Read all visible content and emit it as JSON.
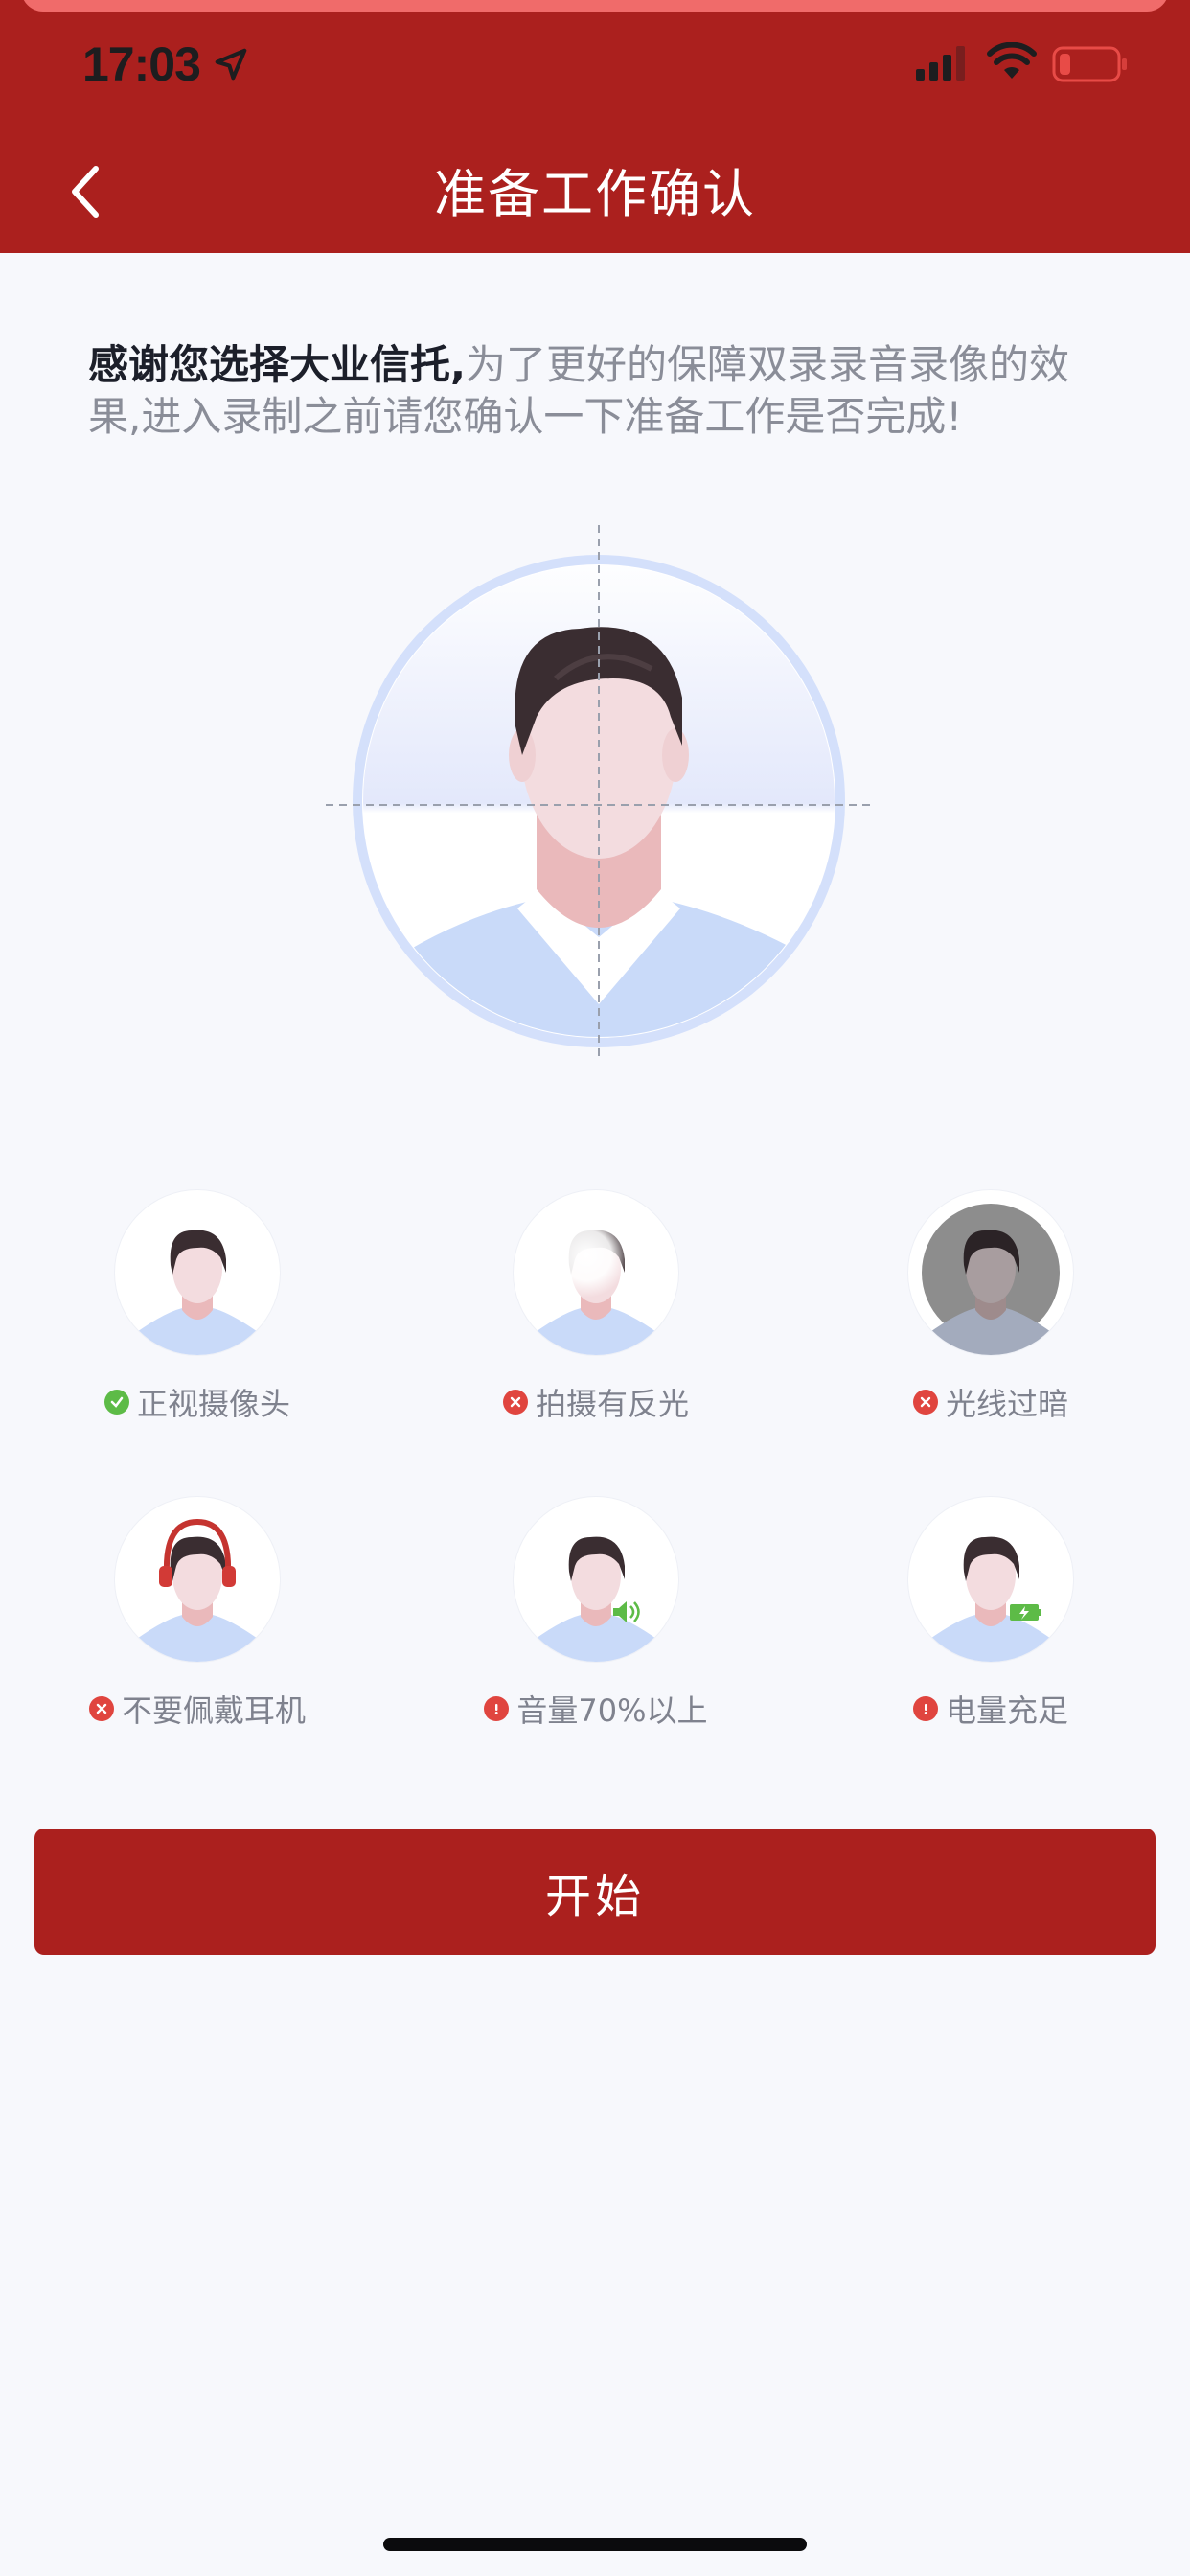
{
  "status_bar": {
    "time": "17:03"
  },
  "colors": {
    "brand": "#ab201e",
    "success": "#5dbb47",
    "error": "#e0453f",
    "background": "#f7f8fc"
  },
  "nav": {
    "title": "准备工作确认",
    "back_icon": "chevron-left-icon"
  },
  "intro": {
    "bold": "感谢您选择大业信托,",
    "text": "为了更好的保障双录录音录像的效果,进入录制之前请您确认一下准备工作是否完成!"
  },
  "options": [
    {
      "label": "正视摄像头",
      "status": "ok"
    },
    {
      "label": "拍摄有反光",
      "status": "error"
    },
    {
      "label": "光线过暗",
      "status": "error"
    },
    {
      "label": "不要佩戴耳机",
      "status": "error"
    },
    {
      "label": "音量70%以上",
      "status": "warning"
    },
    {
      "label": "电量充足",
      "status": "warning"
    }
  ],
  "start_button": {
    "label": "开始"
  }
}
